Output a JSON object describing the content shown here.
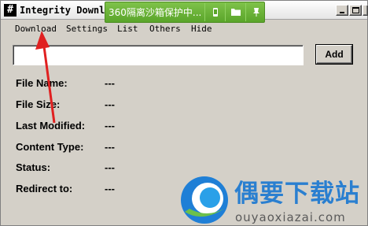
{
  "window": {
    "icon_glyph": "#",
    "title": "Integrity Downlo",
    "controls": [
      "minimize",
      "maximize",
      "close"
    ]
  },
  "sandbox": {
    "text": "360隔离沙箱保护中...",
    "buttons": [
      "phone-icon",
      "folder-icon",
      "pin-icon"
    ],
    "color": "#5aa52a"
  },
  "menu": [
    "Download",
    "Settings",
    "List",
    "Others",
    "Hide"
  ],
  "url_input": {
    "value": "",
    "placeholder": ""
  },
  "add_button": "Add",
  "info": [
    {
      "label": "File Name:",
      "value": "---"
    },
    {
      "label": "File Size:",
      "value": "---"
    },
    {
      "label": "Last Modified:",
      "value": "---"
    },
    {
      "label": "Content Type:",
      "value": "---"
    },
    {
      "label": "Status:",
      "value": "---"
    },
    {
      "label": "Redirect to:",
      "value": "---"
    }
  ],
  "watermark": {
    "cn": "偶要下载站",
    "en": "ouyaoxiazai.com",
    "color": "#2a7fd0"
  },
  "annotation": {
    "type": "red-arrow",
    "color": "#e02020",
    "points_to": "Download"
  }
}
